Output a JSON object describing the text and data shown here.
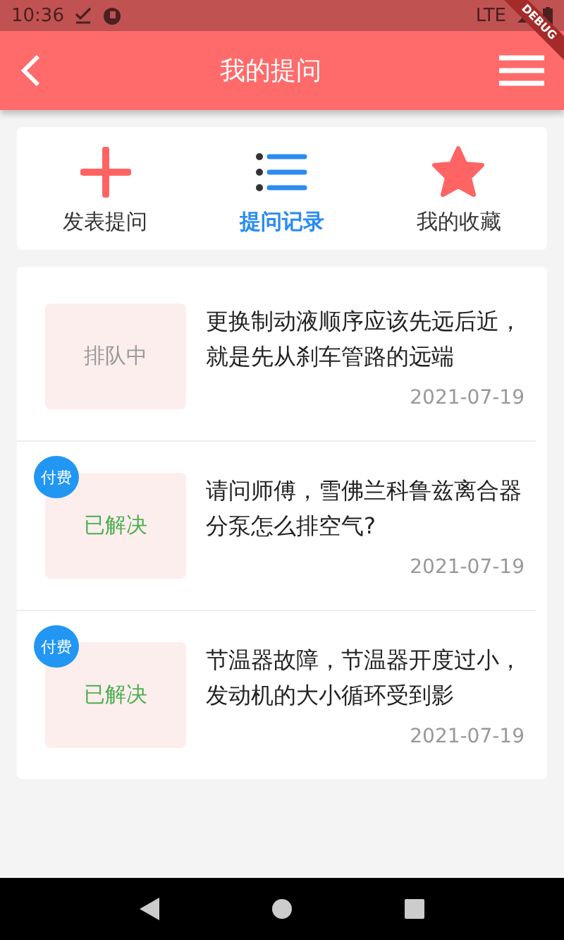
{
  "status_bar": {
    "time": "10:36",
    "network": "LTE"
  },
  "debug_banner": "DEBUG",
  "app_bar": {
    "title": "我的提问"
  },
  "tabs": [
    {
      "label": "发表提问",
      "kind": "plus",
      "selected": false
    },
    {
      "label": "提问记录",
      "kind": "list",
      "selected": true
    },
    {
      "label": "我的收藏",
      "kind": "star",
      "selected": false
    }
  ],
  "questions": [
    {
      "status": "排队中",
      "kind": "queued",
      "text": "更换制动液顺序应该先远后近，就是先从刹车管路的远端",
      "date": "2021-07-19"
    },
    {
      "badge": "付费",
      "status": "已解决",
      "kind": "solved",
      "text": "请问师傅，雪佛兰科鲁兹离合器分泵怎么排空气?",
      "date": "2021-07-19"
    },
    {
      "badge": "付费",
      "status": "已解决",
      "kind": "solved",
      "text": "节温器故障，节温器开度过小，发动机的大小循环受到影",
      "date": "2021-07-19"
    }
  ]
}
